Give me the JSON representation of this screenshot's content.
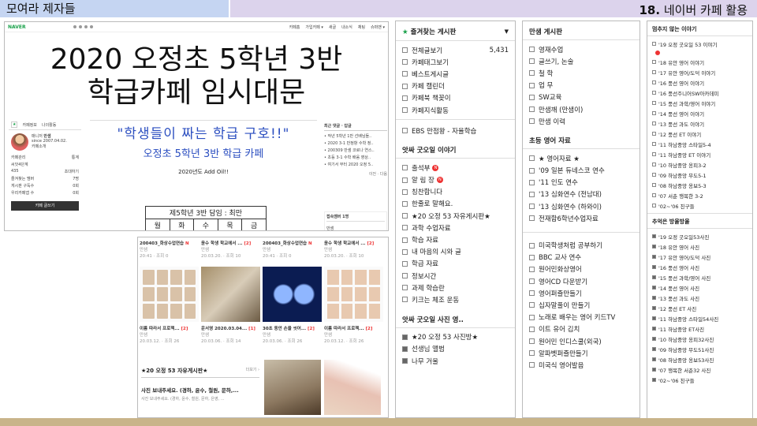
{
  "header": {
    "left": "모여라 제자들",
    "right_num": "18.",
    "right_text": "네이버 카페 활용"
  },
  "cafe": {
    "logo": "NAVER",
    "top_menu": [
      "카페홈",
      "가입카페 ▾",
      "새글",
      "내소식",
      "채팅",
      "슈퍼맨 ▾"
    ],
    "title_line1": "2020 오정초 5학년 3반",
    "title_line2": "학급카페 임시대문",
    "sidebar": {
      "tab1": "카페정보",
      "tab2": "나의활동",
      "manager": "매니저",
      "manager_name": "만샘",
      "since": "since 2007.04.02.",
      "intro": "카페소개",
      "manage": "카페관리",
      "stat": "통계",
      "level": "씨앗4단계",
      "members_icon": "435",
      "invite": "초대하기",
      "rows": [
        {
          "k": "즐겨찾는 멤버",
          "v": "7명"
        },
        {
          "k": "게시판 구독수",
          "v": "0회"
        },
        {
          "k": "우리카페앱 수",
          "v": "0회"
        }
      ],
      "write": "카페 글쓰기"
    },
    "poster": {
      "quote": "\"학생들이 짜는 학급 구호!!\"",
      "sub": "오정초 5학년 3반 학급 카페",
      "year": "2020년도 Add Oil!!",
      "table_title": "제5학년 3반 담임 : 최만",
      "days": [
        "월",
        "화",
        "수",
        "목",
        "금"
      ]
    },
    "recent": {
      "title": "최근 댓글 · 답글",
      "items": [
        "• 작년 5학년 1반 선배님들..",
        "• 2020 3-1 만정항 수학 정..",
        "• 200309 만샘 코로나 연스..",
        "• 초등 3-1 수학 배움 영상..",
        "• 여기서 부터 2020 오정 5.."
      ],
      "more": "이전 · 다음"
    },
    "members": {
      "title": "접속멤버 1명",
      "name": "만샘"
    }
  },
  "feed": {
    "cards": [
      {
        "title": "200403_화상수업연습",
        "badge": "N",
        "author": "만샘",
        "meta": "20:41 · 조회 0",
        "cap": "이름 따라서 프로젝...",
        "cnt": "[2]",
        "cap_meta": "20.03.12. · 조회 26"
      },
      {
        "title": "윤수 학생 학교에서 ...",
        "badge": "[2]",
        "author": "만샘",
        "meta": "20.03.20. · 조회 10",
        "cap": "운서영 2020.03.04...",
        "cnt": "[1]",
        "cap_meta": "20.03.06. · 조회 14"
      },
      {
        "title": "200403_화상수업연습",
        "badge": "N",
        "author": "만샘",
        "meta": "20:41 · 조회 0",
        "cap": "30초 동안 손을 씻어...",
        "cnt": "[2]",
        "cap_meta": "20.03.06. · 조회 26"
      },
      {
        "title": "윤수 학생 학교에서 ...",
        "badge": "[2]",
        "author": "만샘",
        "meta": "20.03.20. · 조회 10",
        "cap": "이름 따라서 프로젝...",
        "cnt": "[2]",
        "cap_meta": "20.03.12. · 조회 26"
      }
    ],
    "section_title": "★20 오정 53 자유게시판★",
    "section_more": "더보기 ›",
    "post_title": "사진 보내주세요. (경하, 윤수, 철원, 문하,...",
    "post_body": "사진 보내주세요. (경하, 윤수, 철원, 문하, 은영, ...",
    "post_author": "만샘"
  },
  "col1": {
    "fav_title": "즐겨찾는 게시판",
    "fav": [
      {
        "t": "전체글보기",
        "n": "5,431"
      },
      {
        "t": "카페태그보기"
      },
      {
        "t": "베스트게시글"
      },
      {
        "t": "카페 캘린더"
      },
      {
        "t": "카페북 책꽂이"
      },
      {
        "t": "카페지식활동"
      }
    ],
    "ebs": "EBS 만점왕 - 자율학습",
    "s2": "앗싸 굿오일 이야기",
    "s2_items": [
      {
        "t": "출석부",
        "n": "N"
      },
      {
        "t": "알 림 장",
        "n": "N"
      },
      {
        "t": "칭찬합니다"
      },
      {
        "t": "한줄로 말해요."
      },
      {
        "t": "★20 오정 53 자유게시판★"
      },
      {
        "t": "과학 수업자료"
      },
      {
        "t": "학습 자료"
      },
      {
        "t": "내 마음의 시와 글"
      },
      {
        "t": "학급 자료"
      },
      {
        "t": "정보시간"
      },
      {
        "t": "과제 학습란"
      },
      {
        "t": "키크는 체조 운동"
      }
    ],
    "s3": "앗싸 굿오일 사진 영..",
    "s3_items": [
      {
        "t": "★20 오정 53 사진방★"
      },
      {
        "t": "선생님 앨범"
      },
      {
        "t": "나무 거울"
      }
    ]
  },
  "col2": {
    "s1": "만샘 게시판",
    "s1_items": [
      "영재수업",
      "글쓰기, 논술",
      "철 학",
      "업 무",
      "SW교육",
      "만샘깨 (만샘이)",
      "만샘 이력"
    ],
    "s2": "초등 영어 자료",
    "s2_items": [
      "★ 영어자료 ★",
      "'09 일본 듀네스코 연수",
      "'11 인도 연수",
      "'13 심화연수 (전남대)",
      "'13 심화연수 (하와이)",
      "전재함6학년수업자료"
    ],
    "s3_items": [
      "미국학생처럼 공부하기",
      "BBC 교사 연수",
      "원어민화상영어",
      "영어CD 다운받기",
      "영어퍼즐만들기",
      "십자말풀이 만들기",
      "노래로 배우는 영어 키드TV",
      "이트 유어 김치",
      "원어민 인디스쿨(외국)",
      "알파벳퍼즐만들기",
      "미국식 영어발음"
    ]
  },
  "col3": {
    "s1": "멈추지 않는 이야기",
    "s1_items": [
      "'19 오정 굿오일 53 이야기",
      "'18 유안 영어 이야기",
      "'17 유안 영어/도덕 이야기",
      "'16 풍선 영어 이야기",
      "'16 풍선주니어SW아카데미",
      "'15 풍선 과학/영어 이야기",
      "'14 풍선 영어 이야기",
      "'13 풍선 과도 이야기",
      "'12 풍선 ET 이야기",
      "'11 하남중앙 스타일5-4",
      "'11 하남중앙 ET 이야기",
      "'10 하남중앙 옹피3-2",
      "'09 하남중앙 무도5-1",
      "'08 하남중앙 옹보5-3",
      "'07 서춘 행복한 3-2",
      "'02~'06 친구들"
    ],
    "s2": "추억은 방울방울",
    "s2_items": [
      "'19 오정 굿오일53사진",
      "'18 유안 영어 사진",
      "'17 유안 영어/도덕 사진",
      "'16 풍선 영어 사진",
      "'15 풍선 과학/영어 사진",
      "'14 풍선 영어 사진",
      "'13 풍선 과도 사진",
      "'12 풍선 ET 사진",
      "'11 하남중앙 스타일54사진",
      "'11 하남중앙 ET사진",
      "'10 하남중앙 옹피32사진",
      "'09 하남중앙 무도51사진",
      "'08 하남중앙 옹보53사진",
      "'07 행복한 서춘32 사진",
      "'02~'06 친구들"
    ]
  }
}
